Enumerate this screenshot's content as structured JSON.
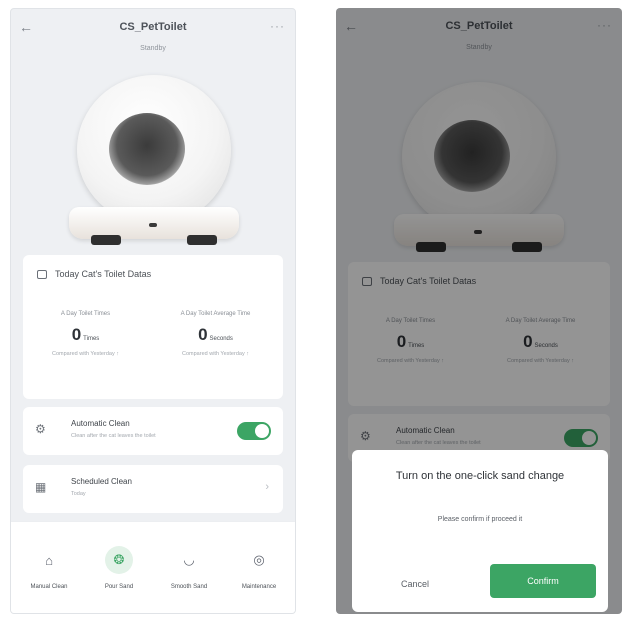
{
  "app": {
    "title": "CS_PetToilet",
    "status": "Standby",
    "back_icon": "arrow-left-icon",
    "more_icon": "more-horizontal-icon"
  },
  "stats": {
    "header": "Today Cat's Toilet Datas",
    "header_icon": "calendar-icon",
    "times": {
      "label": "A Day Toilet Times",
      "value": "0",
      "unit": "Times",
      "compare": "Compared with Yesterday"
    },
    "avg": {
      "label": "A Day Toilet Average Time",
      "value": "0",
      "unit": "Seconds",
      "compare": "Compared with Yesterday"
    }
  },
  "automatic_clean": {
    "icon": "gear-icon",
    "title": "Automatic Clean",
    "subtitle": "Clean after the cat leaves the toilet",
    "enabled": true
  },
  "scheduled_clean": {
    "icon": "calendar-icon",
    "title": "Scheduled Clean",
    "subtitle": "Today"
  },
  "bottom_nav": [
    {
      "label": "Manual Clean",
      "icon": "broom-icon",
      "active": false
    },
    {
      "label": "Pour Sand",
      "icon": "sand-icon",
      "active": true
    },
    {
      "label": "Smooth Sand",
      "icon": "bowl-icon",
      "active": false
    },
    {
      "label": "Maintenance",
      "icon": "wrench-icon",
      "active": false
    }
  ],
  "dialog": {
    "title": "Turn on the one-click sand change",
    "message": "Please confirm if proceed it",
    "cancel_label": "Cancel",
    "confirm_label": "Confirm"
  },
  "colors": {
    "accent": "#3ca564",
    "background": "#eef0f3",
    "overlay": "rgba(0,0,0,0.42)"
  }
}
